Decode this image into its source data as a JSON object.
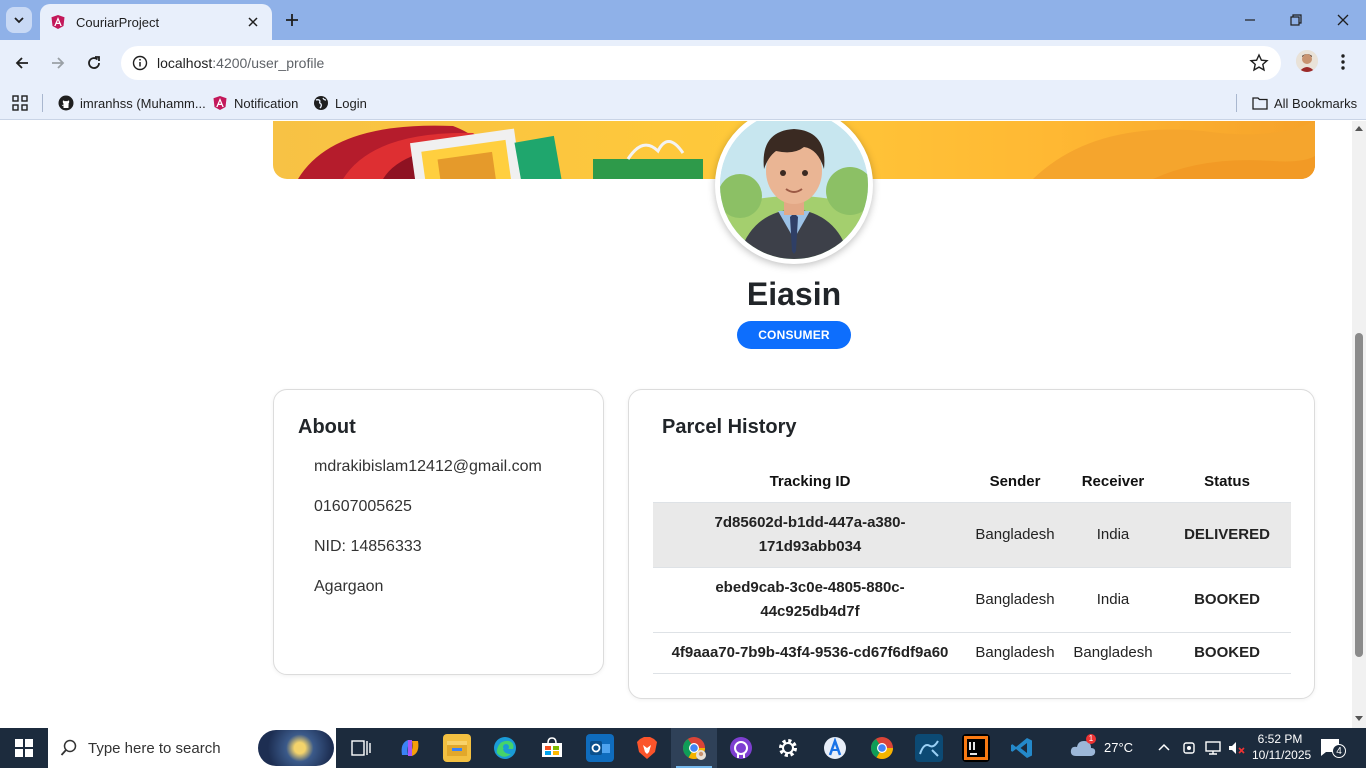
{
  "browser": {
    "tab_title": "CouriarProject",
    "url_host": "localhost",
    "url_path": ":4200/user_profile",
    "bookmarks": [
      "imranhss (Muhamm...",
      "Notification",
      "Login"
    ],
    "all_bookmarks": "All Bookmarks"
  },
  "profile": {
    "name": "Eiasin",
    "role": "CONSUMER"
  },
  "about": {
    "title": "About",
    "email": "mdrakibislam12412@gmail.com",
    "phone": "01607005625",
    "nid": "NID: 14856333",
    "address": "Agargaon"
  },
  "history": {
    "title": "Parcel History",
    "columns": [
      "Tracking ID",
      "Sender",
      "Receiver",
      "Status"
    ],
    "rows": [
      {
        "tracking_id_1": "7d85602d-b1dd-447a-a380-",
        "tracking_id_2": "171d93abb034",
        "sender": "Bangladesh",
        "receiver": "India",
        "status": "DELIVERED"
      },
      {
        "tracking_id_1": "ebed9cab-3c0e-4805-880c-",
        "tracking_id_2": "44c925db4d7f",
        "sender": "Bangladesh",
        "receiver": "India",
        "status": "BOOKED"
      },
      {
        "tracking_id_1": "4f9aaa70-7b9b-43f4-9536-cd67f6df9a60",
        "sender": "Bangladesh",
        "receiver": "Bangladesh",
        "status": "BOOKED"
      }
    ]
  },
  "taskbar": {
    "search_placeholder": "Type here to search",
    "weather": "27°C",
    "weather_badge": "1",
    "time": "6:52 PM",
    "date": "10/11/2025",
    "notifications": "4"
  },
  "colors": {
    "accent": "#0d6efd",
    "banner": "#ffc93a",
    "taskbar": "#1c2b3d",
    "tabstrip": "#8fb1e8"
  }
}
